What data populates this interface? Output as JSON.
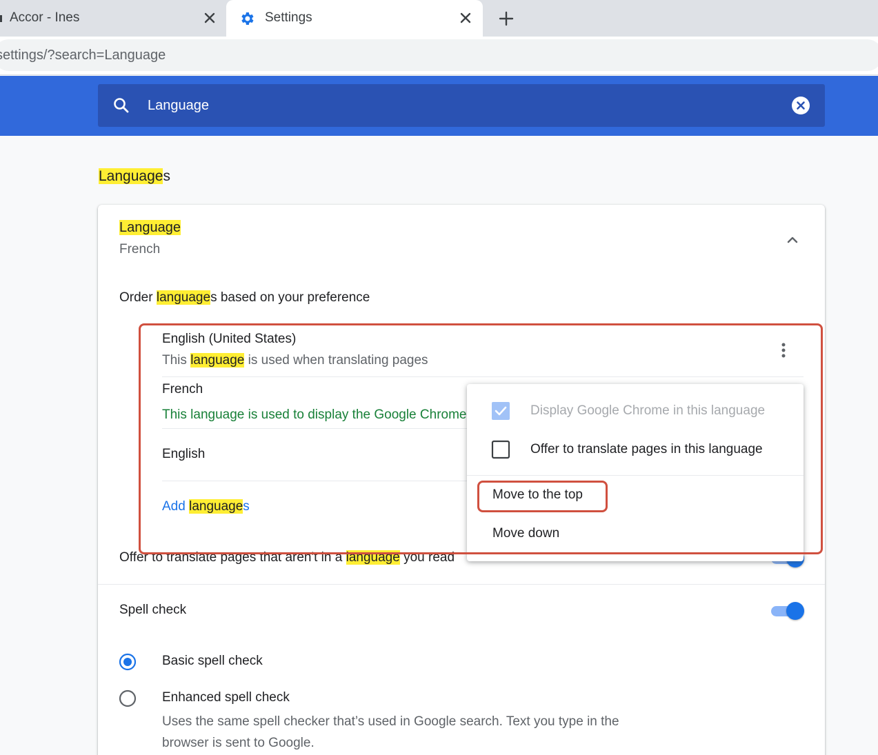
{
  "browser": {
    "tabs": [
      {
        "title": "Accor - Ines",
        "active": false
      },
      {
        "title": "Settings",
        "active": true
      }
    ],
    "url": "settings/?search=Language"
  },
  "search": {
    "query": "Language"
  },
  "section": {
    "title_highlight": "Language",
    "title_rest": "s"
  },
  "language_card": {
    "heading": "Language",
    "current_value": "French",
    "order_prefix": "Order ",
    "order_highlight": "language",
    "order_suffix": "s based on your preference",
    "languages": [
      {
        "name": "English (United States)",
        "sub_prefix": "This ",
        "sub_highlight": "language",
        "sub_suffix": " is used when translating pages"
      },
      {
        "name": "French",
        "sub": "This language is used to display the Google Chrome"
      },
      {
        "name": "English"
      }
    ],
    "add_prefix": "Add ",
    "add_highlight": "language",
    "add_suffix": "s",
    "offer_prefix": "Offer to translate pages that aren't in a ",
    "offer_highlight": "language",
    "offer_suffix": " you read"
  },
  "menu": {
    "display_in_language": {
      "label": "Display Google Chrome in this language",
      "checked": true,
      "disabled": true
    },
    "offer_translate": {
      "label": "Offer to translate pages in this language",
      "checked": false
    },
    "move_top": "Move to the top",
    "move_down": "Move down"
  },
  "spell_check": {
    "label": "Spell check",
    "enabled": true,
    "options": [
      {
        "label": "Basic spell check",
        "selected": true
      },
      {
        "label": "Enhanced spell check",
        "selected": false,
        "description": "Uses the same spell checker that’s used in Google search. Text you type in the browser is sent to Google."
      }
    ]
  },
  "colors": {
    "accent": "#1a73e8",
    "header_blue": "#3169db",
    "highlight": "#ffee33",
    "annotation": "#d0503f"
  }
}
